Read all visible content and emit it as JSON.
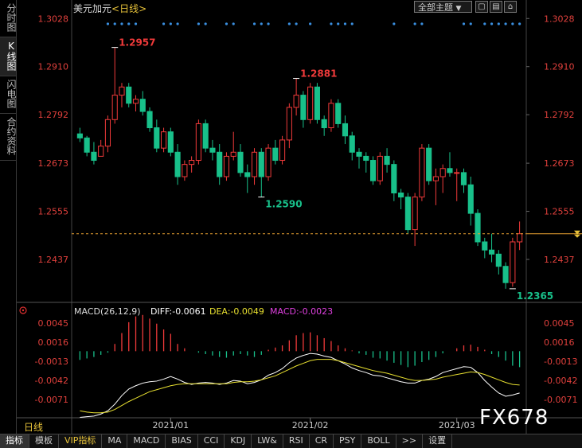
{
  "side_tabs": [
    {
      "label": "分时图",
      "active": false
    },
    {
      "label": "K线图",
      "active": true
    },
    {
      "label": "闪电图",
      "active": false
    },
    {
      "label": "合约资料",
      "active": false
    }
  ],
  "header": {
    "symbol": "美元加元",
    "period": "<日线>",
    "theme_label": "全部主题",
    "theme_arrow": "▼"
  },
  "window_buttons": {
    "restore": "▢",
    "grid": "▤",
    "close": "⌂"
  },
  "price_axis": {
    "ticks": [
      "1.3028",
      "1.2910",
      "1.2792",
      "1.2673",
      "1.2555",
      "1.2437"
    ],
    "tick_values": [
      1.3028,
      1.291,
      1.2792,
      1.2673,
      1.2555,
      1.2437
    ],
    "color": "#e0403c"
  },
  "annotations": {
    "high1": {
      "label": "1.2957",
      "value": 1.2957,
      "idx": 5
    },
    "high2": {
      "label": "1.2881",
      "value": 1.2881,
      "idx": 31
    },
    "low1": {
      "label": "1.2590",
      "value": 1.259,
      "idx": 26
    },
    "low2": {
      "label": "1.2365",
      "value": 1.2365,
      "idx": 62
    }
  },
  "current_price": 1.25,
  "x_axis": {
    "labels": [
      {
        "text": "2021/01",
        "idx": 13
      },
      {
        "text": "2021/02",
        "idx": 33
      },
      {
        "text": "2021/03",
        "idx": 54
      }
    ]
  },
  "macd": {
    "title": "MACD(26,12,9)",
    "diff_label": "DIFF:-0.0061",
    "dea_label": "DEA:-0.0049",
    "macd_label": "MACD:-0.0023",
    "ticks": [
      "0.0045",
      "0.0016",
      "-0.0013",
      "-0.0042",
      "-0.0071"
    ],
    "tick_values": [
      0.0045,
      0.0016,
      -0.0013,
      -0.0042,
      -0.0071
    ]
  },
  "bottom_tabs": [
    {
      "label": "指标",
      "active": true,
      "vip": false
    },
    {
      "label": "模板",
      "active": false,
      "vip": false
    },
    {
      "label": "VIP指标",
      "active": false,
      "vip": true
    },
    {
      "label": "MA",
      "active": false,
      "vip": false
    },
    {
      "label": "MACD",
      "active": false,
      "vip": false
    },
    {
      "label": "BIAS",
      "active": false,
      "vip": false
    },
    {
      "label": "CCI",
      "active": false,
      "vip": false
    },
    {
      "label": "KDJ",
      "active": false,
      "vip": false
    },
    {
      "label": "LW&",
      "active": false,
      "vip": false
    },
    {
      "label": "RSI",
      "active": false,
      "vip": false
    },
    {
      "label": "CR",
      "active": false,
      "vip": false
    },
    {
      "label": "PSY",
      "active": false,
      "vip": false
    },
    {
      "label": "BOLL",
      "active": false,
      "vip": false
    },
    {
      "label": ">>",
      "active": false,
      "vip": false
    },
    {
      "label": "设置",
      "active": false,
      "vip": false
    }
  ],
  "period_tag": "日线",
  "watermark": "FX678",
  "colors": {
    "up": "#f03a3a",
    "down": "#18c08a",
    "dif": "#ffffff",
    "dea": "#e8e030",
    "macd_text": "#e040e0",
    "dot": "#3a8fe0"
  },
  "chart_data": {
    "type": "candlestick",
    "candles": [
      [
        1.2745,
        1.276,
        1.2725,
        1.2735
      ],
      [
        1.2735,
        1.274,
        1.269,
        1.27
      ],
      [
        1.27,
        1.2725,
        1.267,
        1.268
      ],
      [
        1.269,
        1.273,
        1.269,
        1.2715
      ],
      [
        1.2715,
        1.279,
        1.27,
        1.278
      ],
      [
        1.278,
        1.2957,
        1.277,
        1.284
      ],
      [
        1.284,
        1.287,
        1.281,
        1.286
      ],
      [
        1.286,
        1.287,
        1.281,
        1.282
      ],
      [
        1.282,
        1.284,
        1.28,
        1.283
      ],
      [
        1.283,
        1.285,
        1.279,
        1.28
      ],
      [
        1.28,
        1.281,
        1.275,
        1.276
      ],
      [
        1.276,
        1.278,
        1.27,
        1.271
      ],
      [
        1.271,
        1.276,
        1.27,
        1.275
      ],
      [
        1.275,
        1.276,
        1.269,
        1.27
      ],
      [
        1.27,
        1.272,
        1.262,
        1.264
      ],
      [
        1.264,
        1.268,
        1.263,
        1.267
      ],
      [
        1.267,
        1.269,
        1.265,
        1.268
      ],
      [
        1.268,
        1.278,
        1.267,
        1.277
      ],
      [
        1.277,
        1.278,
        1.27,
        1.271
      ],
      [
        1.271,
        1.273,
        1.268,
        1.27
      ],
      [
        1.27,
        1.272,
        1.262,
        1.264
      ],
      [
        1.264,
        1.27,
        1.263,
        1.269
      ],
      [
        1.269,
        1.275,
        1.268,
        1.27
      ],
      [
        1.27,
        1.272,
        1.264,
        1.265
      ],
      [
        1.265,
        1.267,
        1.26,
        1.264
      ],
      [
        1.264,
        1.271,
        1.262,
        1.27
      ],
      [
        1.27,
        1.271,
        1.259,
        1.264
      ],
      [
        1.264,
        1.272,
        1.263,
        1.271
      ],
      [
        1.271,
        1.273,
        1.267,
        1.268
      ],
      [
        1.268,
        1.274,
        1.267,
        1.273
      ],
      [
        1.273,
        1.282,
        1.271,
        1.281
      ],
      [
        1.281,
        1.2881,
        1.279,
        1.284
      ],
      [
        1.284,
        1.285,
        1.276,
        1.278
      ],
      [
        1.278,
        1.287,
        1.277,
        1.286
      ],
      [
        1.286,
        1.287,
        1.277,
        1.278
      ],
      [
        1.278,
        1.279,
        1.274,
        1.276
      ],
      [
        1.276,
        1.283,
        1.275,
        1.282
      ],
      [
        1.282,
        1.283,
        1.276,
        1.277
      ],
      [
        1.277,
        1.279,
        1.272,
        1.274
      ],
      [
        1.274,
        1.275,
        1.268,
        1.27
      ],
      [
        1.27,
        1.271,
        1.266,
        1.269
      ],
      [
        1.269,
        1.27,
        1.265,
        1.268
      ],
      [
        1.268,
        1.269,
        1.262,
        1.263
      ],
      [
        1.263,
        1.27,
        1.262,
        1.269
      ],
      [
        1.269,
        1.271,
        1.265,
        1.267
      ],
      [
        1.267,
        1.268,
        1.258,
        1.26
      ],
      [
        1.26,
        1.261,
        1.256,
        1.259
      ],
      [
        1.259,
        1.26,
        1.25,
        1.251
      ],
      [
        1.251,
        1.26,
        1.247,
        1.259
      ],
      [
        1.259,
        1.272,
        1.258,
        1.271
      ],
      [
        1.271,
        1.272,
        1.262,
        1.263
      ],
      [
        1.263,
        1.266,
        1.257,
        1.264
      ],
      [
        1.264,
        1.267,
        1.26,
        1.266
      ],
      [
        1.266,
        1.27,
        1.264,
        1.265
      ],
      [
        1.265,
        1.266,
        1.258,
        1.265
      ],
      [
        1.265,
        1.266,
        1.26,
        1.262
      ],
      [
        1.262,
        1.264,
        1.252,
        1.255
      ],
      [
        1.255,
        1.256,
        1.247,
        1.248
      ],
      [
        1.248,
        1.249,
        1.244,
        1.246
      ],
      [
        1.246,
        1.25,
        1.243,
        1.245
      ],
      [
        1.245,
        1.246,
        1.24,
        1.242
      ],
      [
        1.242,
        1.243,
        1.2365,
        1.238
      ],
      [
        1.238,
        1.249,
        1.237,
        1.248
      ],
      [
        1.248,
        1.253,
        1.246,
        1.25
      ]
    ],
    "macd_hist": [
      -0.0012,
      -0.001,
      -0.0008,
      -0.0005,
      -0.0002,
      0.001,
      0.0025,
      0.004,
      0.0048,
      0.005,
      0.0045,
      0.0038,
      0.003,
      0.0024,
      0.001,
      0.0004,
      0.0,
      -0.0002,
      -0.0004,
      -0.0006,
      -0.0008,
      -0.0009,
      -0.0006,
      -0.0004,
      -0.0006,
      -0.0008,
      -0.0005,
      0.0002,
      0.0005,
      0.0008,
      0.0015,
      0.0022,
      0.0025,
      0.0026,
      0.0022,
      0.0018,
      0.0014,
      0.0008,
      0.0004,
      0.0001,
      -0.0003,
      -0.0005,
      -0.0009,
      -0.001,
      -0.0013,
      -0.0016,
      -0.0019,
      -0.0022,
      -0.002,
      -0.0015,
      -0.0012,
      -0.0008,
      -0.0003,
      0.0,
      0.0004,
      0.0008,
      0.0009,
      0.0006,
      0.0002,
      -0.0004,
      -0.0008,
      -0.0013,
      -0.002,
      -0.0022
    ],
    "dif": [
      -0.0098,
      -0.0097,
      -0.0096,
      -0.0093,
      -0.0088,
      -0.0078,
      -0.0065,
      -0.0055,
      -0.005,
      -0.0046,
      -0.0044,
      -0.0043,
      -0.004,
      -0.0036,
      -0.004,
      -0.0045,
      -0.0048,
      -0.0046,
      -0.0045,
      -0.0046,
      -0.0048,
      -0.0046,
      -0.0042,
      -0.0043,
      -0.0047,
      -0.0045,
      -0.0041,
      -0.0034,
      -0.003,
      -0.0024,
      -0.0015,
      -0.0008,
      -0.0004,
      -0.0001,
      -0.0002,
      -0.0005,
      -0.0007,
      -0.0012,
      -0.0017,
      -0.0023,
      -0.0027,
      -0.003,
      -0.0034,
      -0.0035,
      -0.0038,
      -0.0041,
      -0.0044,
      -0.0046,
      -0.0046,
      -0.0042,
      -0.004,
      -0.0036,
      -0.003,
      -0.0027,
      -0.0024,
      -0.0021,
      -0.0022,
      -0.003,
      -0.0042,
      -0.0052,
      -0.0061,
      -0.0066,
      -0.0064,
      -0.0061
    ],
    "dea": [
      -0.0088,
      -0.009,
      -0.0091,
      -0.0091,
      -0.009,
      -0.0086,
      -0.008,
      -0.0074,
      -0.0069,
      -0.0064,
      -0.0059,
      -0.0056,
      -0.0053,
      -0.005,
      -0.0048,
      -0.0047,
      -0.0047,
      -0.0047,
      -0.0047,
      -0.0047,
      -0.0047,
      -0.0047,
      -0.0045,
      -0.0044,
      -0.0044,
      -0.0043,
      -0.0041,
      -0.0038,
      -0.0035,
      -0.003,
      -0.0025,
      -0.002,
      -0.0016,
      -0.0012,
      -0.001,
      -0.001,
      -0.001,
      -0.0012,
      -0.0015,
      -0.0018,
      -0.0021,
      -0.0024,
      -0.0027,
      -0.0029,
      -0.0031,
      -0.0034,
      -0.0037,
      -0.004,
      -0.0042,
      -0.0042,
      -0.0041,
      -0.004,
      -0.0037,
      -0.0035,
      -0.0033,
      -0.0031,
      -0.0029,
      -0.003,
      -0.0033,
      -0.0037,
      -0.0041,
      -0.0045,
      -0.0048,
      -0.0049
    ],
    "signal_dots_idx": [
      4,
      5,
      6,
      7,
      8,
      12,
      13,
      14,
      17,
      18,
      21,
      22,
      25,
      26,
      27,
      30,
      31,
      33,
      36,
      37,
      38,
      39,
      45,
      48,
      49,
      55,
      56,
      58,
      59,
      60,
      61,
      62,
      63
    ],
    "ylim": [
      1.2355,
      1.305
    ],
    "macd_ylim": [
      -0.0095,
      0.0062
    ]
  }
}
